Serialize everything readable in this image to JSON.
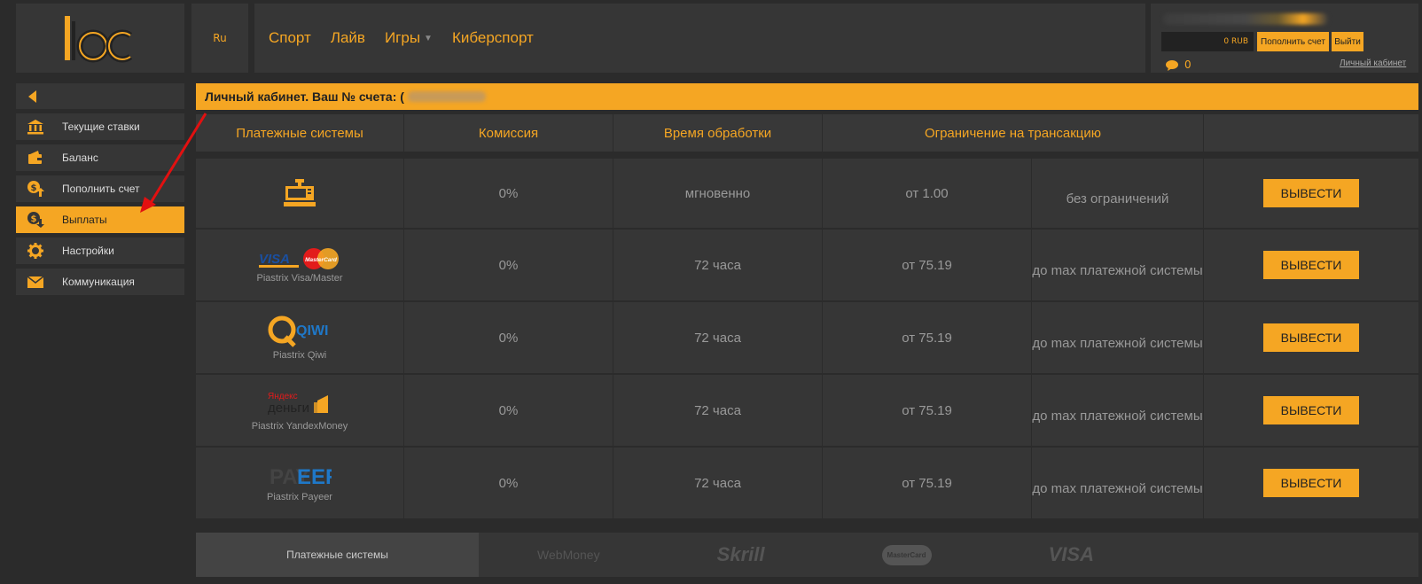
{
  "header": {
    "language": "Ru",
    "nav": [
      {
        "label": "Спорт"
      },
      {
        "label": "Лайв"
      },
      {
        "label": "Игры",
        "has_dropdown": true
      },
      {
        "label": "Киберспорт"
      }
    ]
  },
  "account": {
    "balance": "0 RUB",
    "deposit_label": "Пополнить счет",
    "logout_label": "Выйти",
    "messages_count": "0",
    "cabinet_link": "Личный кабинет"
  },
  "sidebar": {
    "items": [
      {
        "label": "Текущие ставки",
        "icon": "bank-icon"
      },
      {
        "label": "Баланс",
        "icon": "wallet-icon"
      },
      {
        "label": "Пополнить счет",
        "icon": "coin-up-icon"
      },
      {
        "label": "Выплаты",
        "icon": "coin-down-icon",
        "active": true
      },
      {
        "label": "Настройки",
        "icon": "gear-icon"
      },
      {
        "label": "Коммуникация",
        "icon": "envelope-icon"
      }
    ]
  },
  "main": {
    "title": "Личный кабинет. Ваш № счета: (",
    "columns": [
      "Платежные системы",
      "Комиссия",
      "Время обработки",
      "Ограничение на трансакцию"
    ],
    "rows": [
      {
        "name": "",
        "logo": "cash-register-icon",
        "commission": "0%",
        "time": "мгновенно",
        "min": "от 1.00",
        "limit": "без ограничений",
        "button": "ВЫВЕСТИ"
      },
      {
        "name": "Piastrix Visa/Master",
        "logo": "visa-mastercard-logo",
        "commission": "0%",
        "time": "72 часа",
        "min": "от 75.19",
        "limit": "до max платежной системы",
        "button": "ВЫВЕСТИ"
      },
      {
        "name": "Piastrix Qiwi",
        "logo": "qiwi-logo",
        "commission": "0%",
        "time": "72 часа",
        "min": "от 75.19",
        "limit": "до max платежной системы",
        "button": "ВЫВЕСТИ"
      },
      {
        "name": "Piastrix YandexMoney",
        "logo": "yandex-money-logo",
        "commission": "0%",
        "time": "72 часа",
        "min": "от 75.19",
        "limit": "до max платежной системы",
        "button": "ВЫВЕСТИ"
      },
      {
        "name": "Piastrix Payeer",
        "logo": "payeer-logo",
        "commission": "0%",
        "time": "72 часа",
        "min": "от 75.19",
        "limit": "до max платежной системы",
        "button": "ВЫВЕСТИ"
      }
    ],
    "logo_text": {
      "visa": "VISA",
      "mastercard": "MasterCard",
      "qiwi": "QIWI",
      "yandex_1": "Яндекс",
      "yandex_2": "деньги",
      "payeer_1": "PAY",
      "payeer_2": "EER"
    }
  },
  "footer": {
    "label": "Платежные системы",
    "logos": [
      "WebMoney",
      "Skrill",
      "MasterCard",
      "VISA"
    ]
  },
  "colors": {
    "accent": "#f5a623",
    "panel": "#363636",
    "background": "#2b2b2b"
  }
}
